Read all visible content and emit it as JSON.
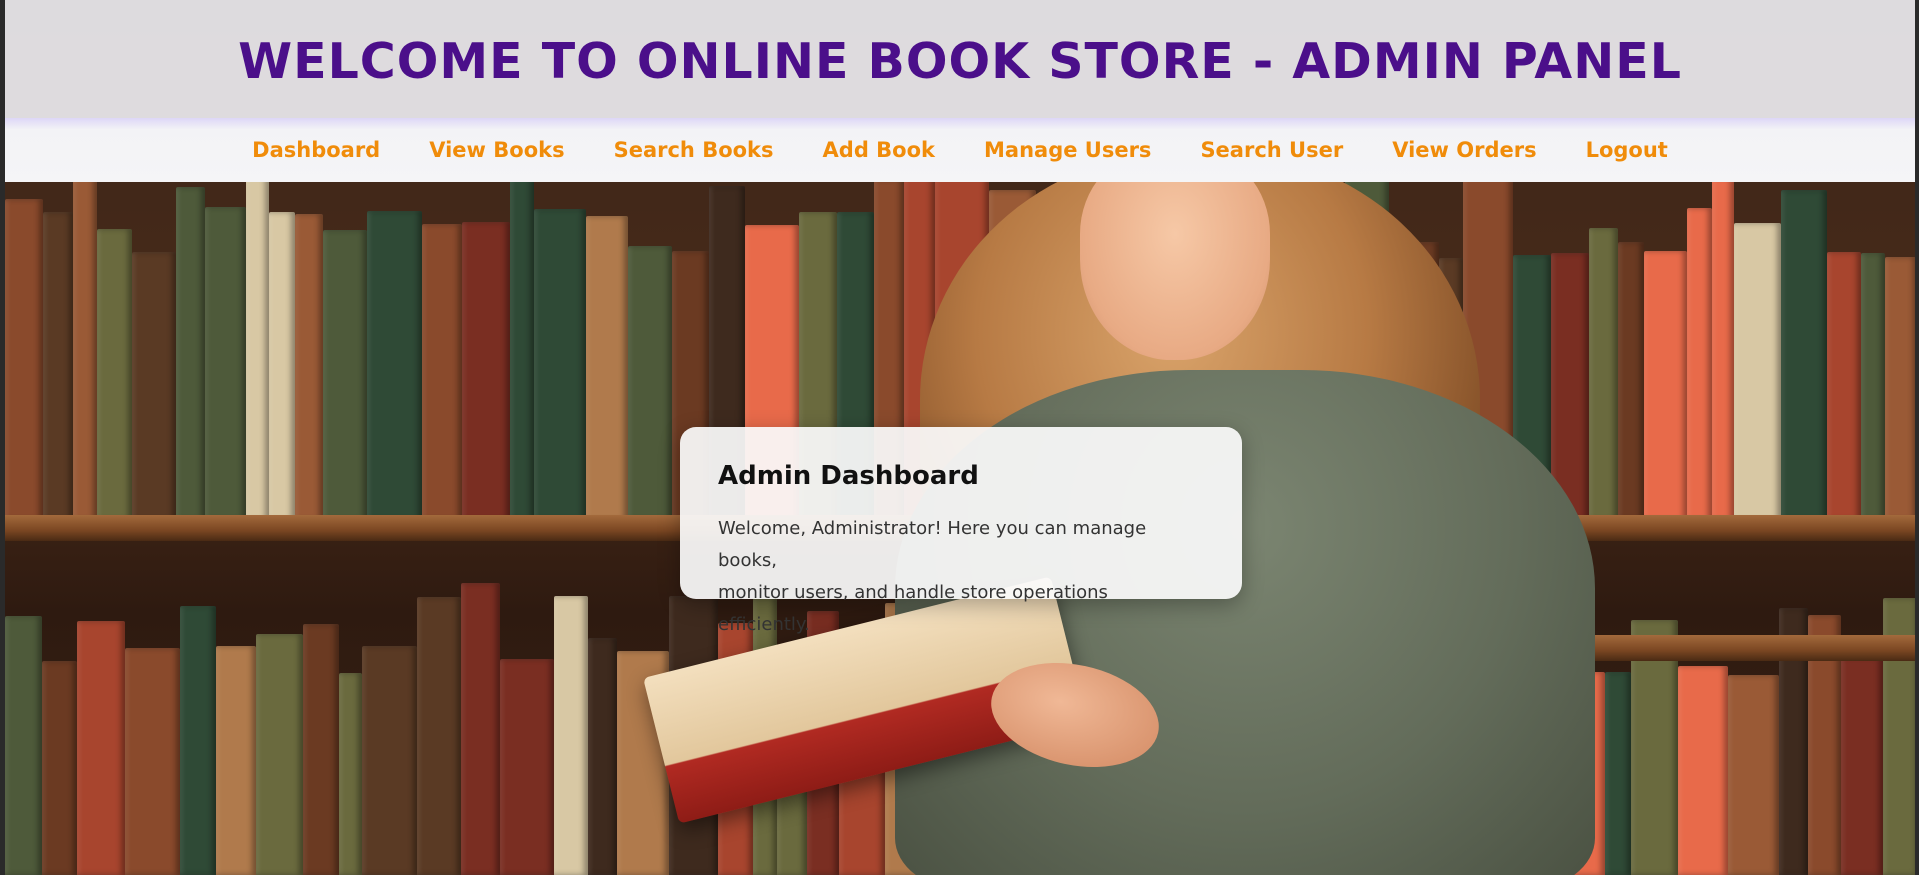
{
  "header": {
    "title": "WELCOME TO ONLINE BOOK STORE - ADMIN PANEL"
  },
  "nav": {
    "items": [
      {
        "label": "Dashboard"
      },
      {
        "label": "View Books"
      },
      {
        "label": "Search Books"
      },
      {
        "label": "Add Book"
      },
      {
        "label": "Manage Users"
      },
      {
        "label": "Search User"
      },
      {
        "label": "View Orders"
      },
      {
        "label": "Logout"
      }
    ]
  },
  "card": {
    "title": "Admin Dashboard",
    "text_line1": "Welcome, Administrator! Here you can manage books,",
    "text_line2": "monitor users, and handle store operations efficiently."
  },
  "colors": {
    "title": "#4b0f8a",
    "nav_link": "#f08c0a",
    "header_bg": "#f0f0f4"
  },
  "background": {
    "image_name": "girl-reading-book-in-library-photo"
  }
}
